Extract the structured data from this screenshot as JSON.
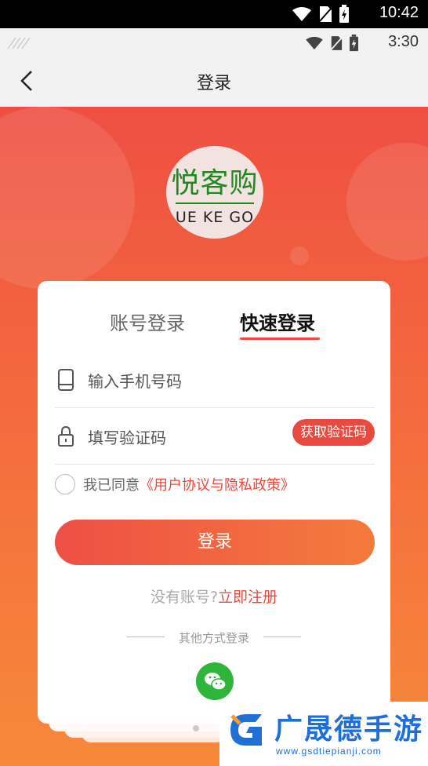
{
  "system_status": {
    "time": "10:42"
  },
  "app_status": {
    "time": "3:30"
  },
  "header": {
    "title": "登录"
  },
  "logo": {
    "brand": "悦客购",
    "sub": "UE KE GO"
  },
  "tabs": {
    "account": "账号登录",
    "quick": "快速登录",
    "active": "quick"
  },
  "form": {
    "phone_placeholder": "输入手机号码",
    "code_placeholder": "填写验证码",
    "get_code_label": "获取验证码"
  },
  "agreement": {
    "prefix": "我已同意",
    "link": "《用户协议与隐私政策》",
    "checked": false
  },
  "login_button": "登录",
  "register": {
    "question": "没有账号?",
    "link": "立即注册"
  },
  "other_login": {
    "label": "其他方式登录",
    "icon": "wechat-icon"
  },
  "watermark": {
    "name": "广晟德手游",
    "url": "www.gsdtiepianji.com"
  },
  "colors": {
    "accent": "#e84a3f",
    "gradient_top": "#ee4f42",
    "gradient_bottom": "#f7893a",
    "wechat": "#2eb53a"
  }
}
